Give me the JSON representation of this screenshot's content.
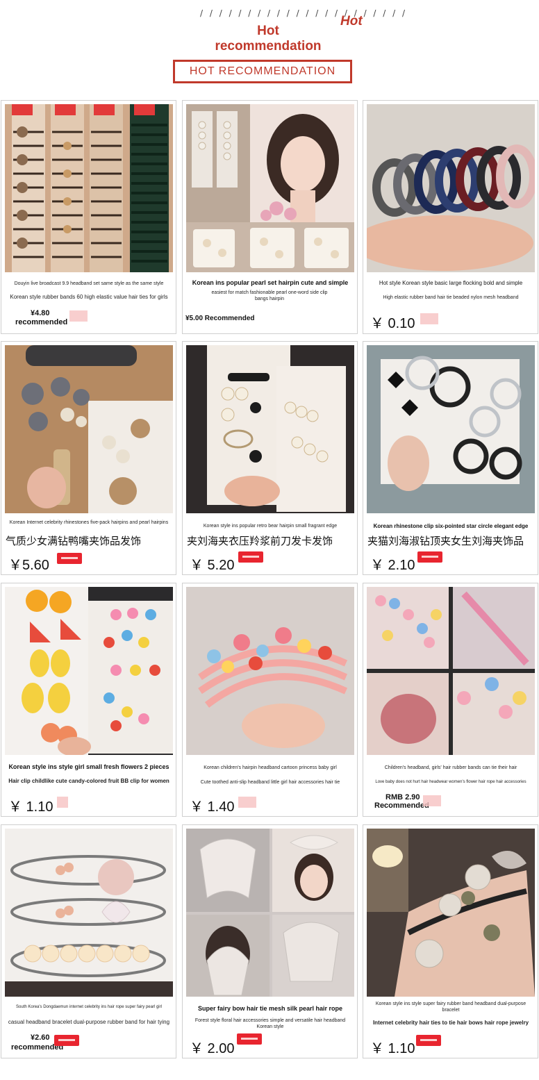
{
  "header": {
    "slashes": "/ / / / / / / / / / / / / / / / / / / / / /",
    "title_line1": "Hot",
    "title_line2": "recommendation",
    "italic_hot": "Hot",
    "banner": "HOT RECOMMENDATION"
  },
  "products": [
    {
      "line1": "Douyin live broadcast 9.9 headband set same style as the same style",
      "line2": "Korean style rubber bands 60 high elastic value hair ties for girls",
      "price": "¥4.80",
      "price_note": "recommended"
    },
    {
      "line1": "Korean ins popular pearl set hairpin cute and simple",
      "line2": "easiest for match fashionable pearl one-word side clip bangs hairpin",
      "price": "¥5.00 Recommended"
    },
    {
      "line1": "Hot style Korean style basic large flocking bold and simple",
      "line2": "High elastic rubber band hair tie beaded nylon mesh headband",
      "price": "￥ 0.10"
    },
    {
      "line1": "Korean Internet celebrity rhinestones five-pack hairpins and pearl hairpins",
      "line2": "气质少女满钻鸭嘴夹饰品发饰",
      "price": "￥5.60"
    },
    {
      "line1": "Korean style ins popular retro bear hairpin small fragrant edge",
      "line2": "夹刘海夹衣压羚浆前刀发卡发饰",
      "price": "￥ 5.20"
    },
    {
      "line1": "Korean rhinestone clip six-pointed star circle elegant edge",
      "line2": "夹猫刘海淑钻顶夹女生刘海夹饰品",
      "price": "￥ 2.10"
    },
    {
      "line1": "Korean style ins style girl small fresh flowers 2 pieces",
      "line2": "Hair clip childlike cute candy-colored fruit BB clip for women",
      "price": "￥ 1.10"
    },
    {
      "line1": "Korean children's hairpin headband cartoon princess baby girl",
      "line2": "Cute toothed anti-slip headband little girl hair accessories hair tie",
      "price": "￥ 1.40"
    },
    {
      "line1": "Children's headband, girls' hair rubber bands can tie their hair",
      "line2": "Love baby does not hurt hair headwear women's flower hair rope hair accessories",
      "price": "RMB 2.90",
      "price_note": "Recommended"
    },
    {
      "line1": "South Korea's Dongdaemun internet celebrity ins hair rope super fairy pearl girl",
      "line2": "casual headband bracelet dual-purpose rubber band for hair tying",
      "price": "¥2.60",
      "price_note": "recommended"
    },
    {
      "line1": "Super fairy bow hair tie mesh silk pearl hair rope",
      "line2": "Forest style floral hair accessories simple and versatile hair headband Korean style",
      "price": "￥ 2.00"
    },
    {
      "line1": "Korean style ins style super fairy rubber band headband dual-purpose bracelet",
      "line2": "Internet celebrity hair ties to tie hair bows hair rope jewelry",
      "price": "￥ 1.10"
    }
  ]
}
